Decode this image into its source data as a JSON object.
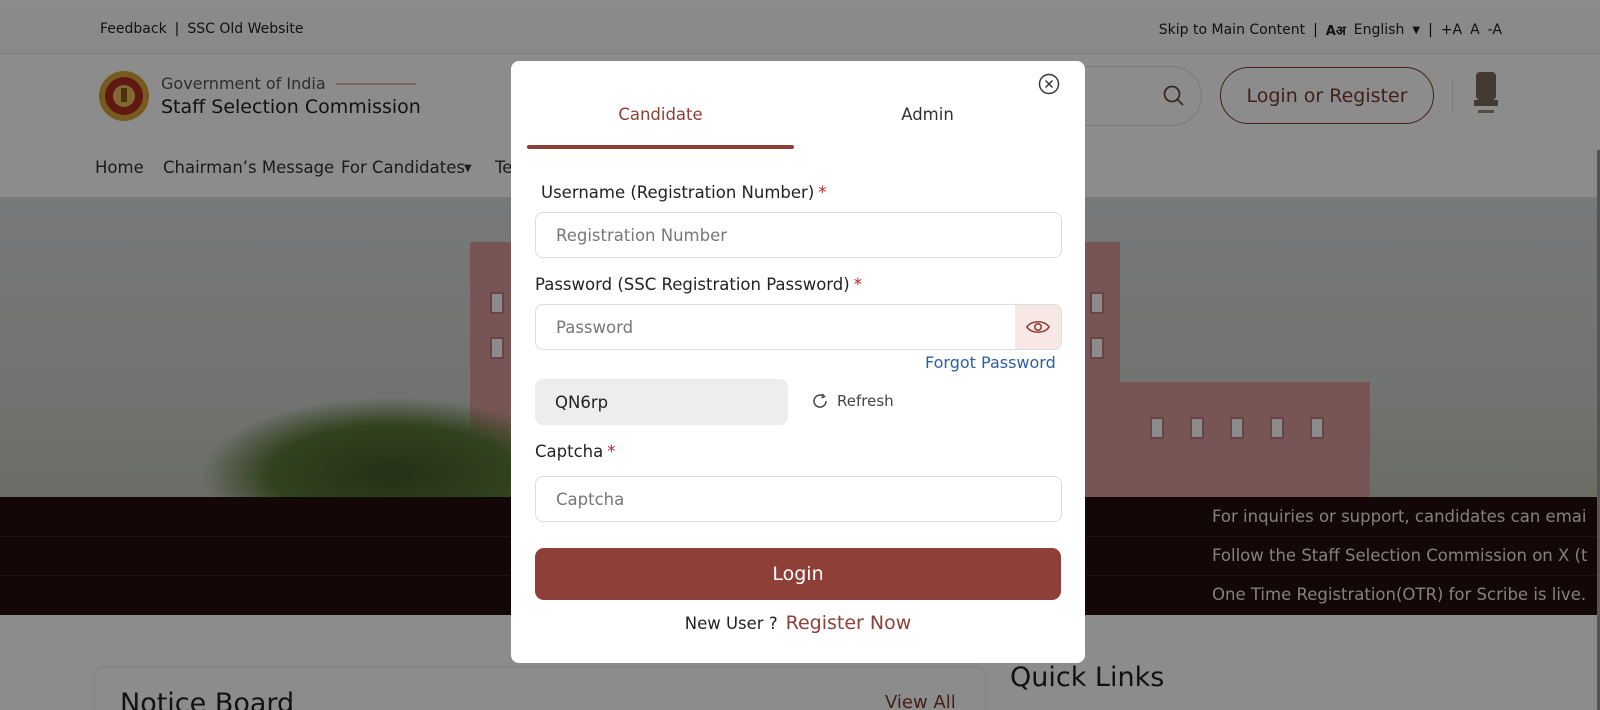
{
  "topbar": {
    "feedback": "Feedback",
    "old_site": "SSC Old Website",
    "skip": "Skip to Main Content",
    "lang_glyph": "Aअ",
    "language": "English",
    "font_plus": "+A",
    "font_normal": "A",
    "font_minus": "-A"
  },
  "header": {
    "gov": "Government of India",
    "org": "Staff Selection Commission",
    "login_register": "Login or Register"
  },
  "nav": {
    "home": "Home",
    "chairman": "Chairman’s Message",
    "candidates": "For Candidates",
    "more": "Te"
  },
  "ticker": [
    "For inquiries or support, candidates can emai",
    "Follow the Staff Selection Commission on X (t",
    "One Time Registration(OTR) for Scribe is live."
  ],
  "sections": {
    "notice_board": "Notice Board",
    "view_all": "View All",
    "quick_links": "Quick Links"
  },
  "modal": {
    "tabs": {
      "candidate": "Candidate",
      "admin": "Admin"
    },
    "username_label": "Username (Registration Number)",
    "username_placeholder": "Registration Number",
    "password_label": "Password (SSC Registration Password)",
    "password_placeholder": "Password",
    "forgot": "Forgot Password",
    "captcha_value": "QN6rp",
    "refresh": "Refresh",
    "captcha_label": "Captcha",
    "captcha_placeholder": "Captcha",
    "required_mark": "*",
    "login": "Login",
    "new_user": "New User ?",
    "register_now": "Register Now"
  },
  "colors": {
    "brand": "#8e3f38",
    "link": "#2a5fa8",
    "ticker_bg": "#230f0d"
  },
  "icons": [
    "close-icon",
    "eye-icon",
    "refresh-icon",
    "search-icon",
    "ssc-emblem-icon",
    "national-emblem-icon",
    "chevron-down-icon",
    "language-icon"
  ]
}
